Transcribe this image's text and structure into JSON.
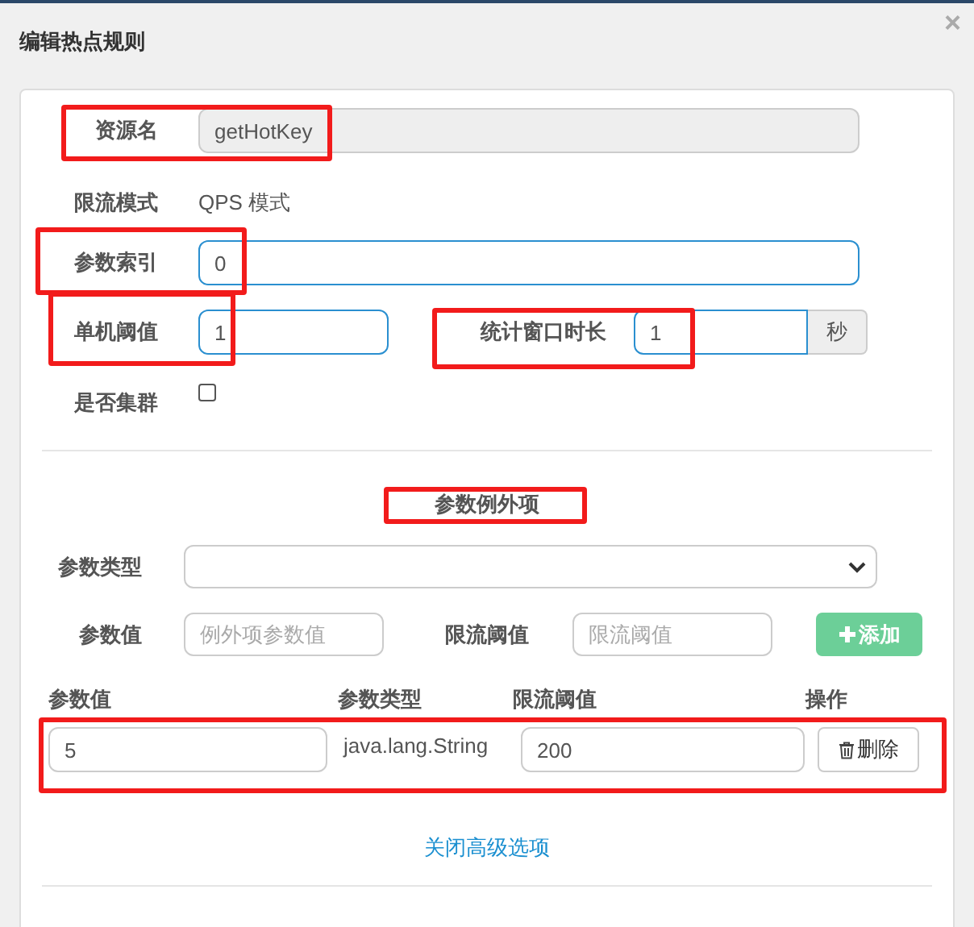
{
  "dialog": {
    "title": "编辑热点规则",
    "close": "×"
  },
  "rule": {
    "resource": {
      "label": "资源名",
      "value": "getHotKey"
    },
    "mode": {
      "label": "限流模式",
      "value": "QPS 模式"
    },
    "param_index": {
      "label": "参数索引",
      "value": "0"
    },
    "threshold": {
      "label": "单机阈值",
      "value": "1"
    },
    "window": {
      "label": "统计窗口时长",
      "value": "1",
      "unit": "秒"
    },
    "cluster": {
      "label": "是否集群",
      "checked": false
    }
  },
  "exceptions": {
    "title": "参数例外项",
    "type_field": {
      "label": "参数类型"
    },
    "value_field": {
      "label": "参数值",
      "placeholder": "例外项参数值"
    },
    "limit_field": {
      "label": "限流阈值",
      "placeholder": "限流阈值"
    },
    "add_button": {
      "label": "添加"
    },
    "table": {
      "columns": [
        "参数值",
        "参数类型",
        "限流阈值",
        "操作"
      ],
      "rows": [
        {
          "value": "5",
          "type": "java.lang.String",
          "limit": "200",
          "action": "删除"
        }
      ]
    }
  },
  "link": "关闭高级选项"
}
